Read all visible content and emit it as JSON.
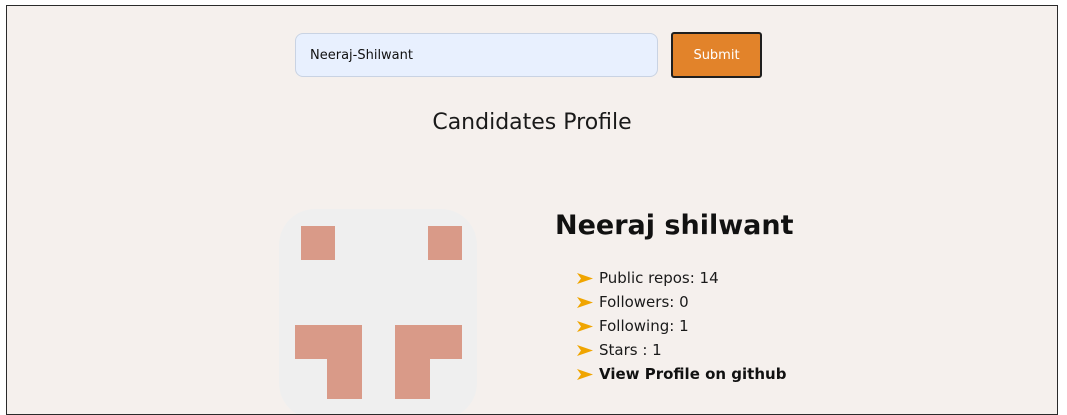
{
  "search": {
    "value": "Neeraj-Shilwant",
    "submit_label": "Submit"
  },
  "page": {
    "title": "Candidates Profile"
  },
  "profile": {
    "name": "Neeraj shilwant",
    "stats": [
      {
        "label": "Public repos: 14"
      },
      {
        "label": "Followers: 0"
      },
      {
        "label": "Following: 1"
      },
      {
        "label": "Stars : 1"
      }
    ],
    "link_label": "View Profile on github"
  },
  "colors": {
    "background": "#f5f0ed",
    "accent": "#e2832a",
    "bullet": "#f0a500",
    "avatar_tile": "#d99a88",
    "input_fill": "#e8f0fe"
  },
  "icons": {
    "bullet": "arrow-right-icon"
  }
}
